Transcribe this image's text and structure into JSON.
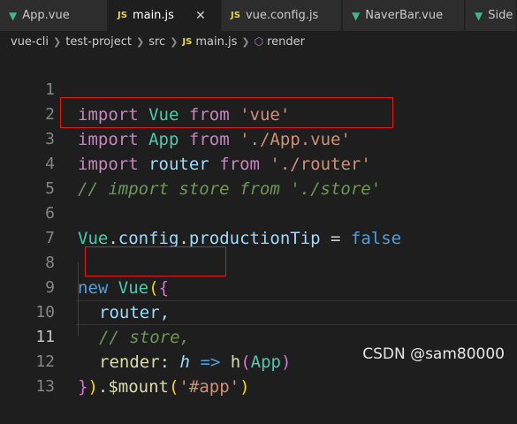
{
  "tabs": [
    {
      "label": "App.vue",
      "icon": "vue-icon"
    },
    {
      "label": "main.js",
      "icon": "js-icon",
      "active": true
    },
    {
      "label": "vue.config.js",
      "icon": "js-icon"
    },
    {
      "label": "NaverBar.vue",
      "icon": "vue-icon"
    },
    {
      "label": "Side",
      "icon": "vue-icon"
    }
  ],
  "breadcrumb": {
    "items": [
      "vue-cli",
      "test-project",
      "src",
      "main.js",
      "render"
    ]
  },
  "lines": {
    "n1": "1",
    "n2": "2",
    "n3": "3",
    "n4": "4",
    "n5": "5",
    "n6": "6",
    "n7": "7",
    "n8": "8",
    "n9": "9",
    "n10": "10",
    "n11": "11",
    "n12": "12",
    "n13": "13"
  },
  "code": {
    "import": "import",
    "from": "from",
    "vue_id": "Vue",
    "vue_str": "'vue'",
    "app_id": "App",
    "app_str": "'./App.vue'",
    "router_id": "router",
    "router_str": "'./router'",
    "store_comment": "// import store from './store'",
    "config": "config",
    "productionTip": "productionTip",
    "eq": " = ",
    "false": "false",
    "new": "new",
    "router_prop": "router,",
    "store_prop_comment": "// store,",
    "render": "render",
    "h": "h",
    "arrow": " => ",
    "mount": "$mount",
    "mount_arg": "'#app'"
  },
  "watermark": "CSDN @sam80000",
  "colors": {
    "highlight_box": "#e0191b",
    "background": "#1e1e1e"
  }
}
